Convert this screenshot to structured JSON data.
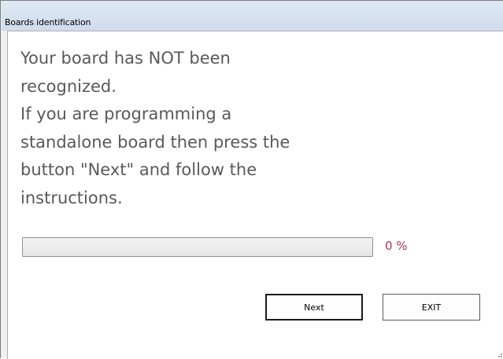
{
  "window": {
    "title": "Boards identification"
  },
  "message": {
    "text": "Your board has NOT been\nrecognized.\nIf you are programming a\nstandalone board then press the\nbutton \"Next\" and follow the\ninstructions."
  },
  "progress": {
    "value_percent": 0,
    "label": "0 %"
  },
  "buttons": {
    "next_label": "Next",
    "exit_label": "EXIT"
  },
  "colors": {
    "message_text": "#595959",
    "percent_text": "#b03060"
  },
  "icons": {
    "resize_grip": "resize-grip-icon"
  }
}
